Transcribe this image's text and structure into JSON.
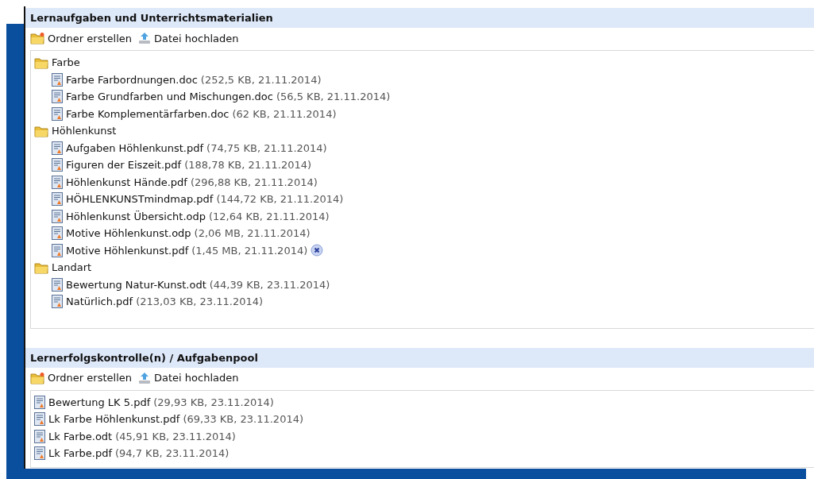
{
  "sections": [
    {
      "title": "Lernaufgaben und Unterrichtsmaterialien",
      "actions": [
        {
          "kind": "folder",
          "label": "Ordner erstellen"
        },
        {
          "kind": "upload",
          "label": "Datei hochladen"
        }
      ],
      "items": [
        {
          "kind": "folder",
          "name": "Farbe",
          "children": [
            {
              "kind": "file",
              "name": "Farbe Farbordnungen.doc",
              "meta": "(252,5 KB, 21.11.2014)",
              "delete_shown": false
            },
            {
              "kind": "file",
              "name": "Farbe Grundfarben und Mischungen.doc",
              "meta": "(56,5 KB, 21.11.2014)",
              "delete_shown": false
            },
            {
              "kind": "file",
              "name": "Farbe Komplementärfarben.doc",
              "meta": "(62 KB, 21.11.2014)",
              "delete_shown": false
            }
          ]
        },
        {
          "kind": "folder",
          "name": "Höhlenkunst",
          "children": [
            {
              "kind": "file",
              "name": "Aufgaben Höhlenkunst.pdf",
              "meta": "(74,75 KB, 21.11.2014)",
              "delete_shown": false
            },
            {
              "kind": "file",
              "name": "Figuren der Eiszeit.pdf",
              "meta": "(188,78 KB, 21.11.2014)",
              "delete_shown": false
            },
            {
              "kind": "file",
              "name": "Höhlenkunst Hände.pdf",
              "meta": "(296,88 KB, 21.11.2014)",
              "delete_shown": false
            },
            {
              "kind": "file",
              "name": "HÖHLENKUNSTmindmap.pdf",
              "meta": "(144,72 KB, 21.11.2014)",
              "delete_shown": false
            },
            {
              "kind": "file",
              "name": "Höhlenkunst Übersicht.odp",
              "meta": "(12,64 KB, 21.11.2014)",
              "delete_shown": false
            },
            {
              "kind": "file",
              "name": "Motive Höhlenkunst.odp",
              "meta": "(2,06 MB, 21.11.2014)",
              "delete_shown": false
            },
            {
              "kind": "file",
              "name": "Motive Höhlenkunst.pdf",
              "meta": "(1,45 MB, 21.11.2014)",
              "delete_shown": true
            }
          ]
        },
        {
          "kind": "folder",
          "name": "Landart",
          "children": [
            {
              "kind": "file",
              "name": "Bewertung Natur-Kunst.odt",
              "meta": "(44,39 KB, 23.11.2014)",
              "delete_shown": false
            },
            {
              "kind": "file",
              "name": "Natürlich.pdf",
              "meta": "(213,03 KB, 23.11.2014)",
              "delete_shown": false
            }
          ]
        }
      ]
    },
    {
      "title": "Lernerfolgskontrolle(n) / Aufgabenpool",
      "actions": [
        {
          "kind": "folder",
          "label": "Ordner erstellen"
        },
        {
          "kind": "upload",
          "label": "Datei hochladen"
        }
      ],
      "items": [
        {
          "kind": "file",
          "name": "Bewertung LK 5.pdf",
          "meta": "(29,93 KB, 23.11.2014)",
          "delete_shown": false
        },
        {
          "kind": "file",
          "name": "Lk Farbe Höhlenkunst.pdf",
          "meta": "(69,33 KB, 23.11.2014)",
          "delete_shown": false
        },
        {
          "kind": "file",
          "name": "Lk Farbe.odt",
          "meta": "(45,91 KB, 23.11.2014)",
          "delete_shown": false
        },
        {
          "kind": "file",
          "name": "Lk Farbe.pdf",
          "meta": "(94,7 KB, 23.11.2014)",
          "delete_shown": false
        }
      ]
    }
  ]
}
